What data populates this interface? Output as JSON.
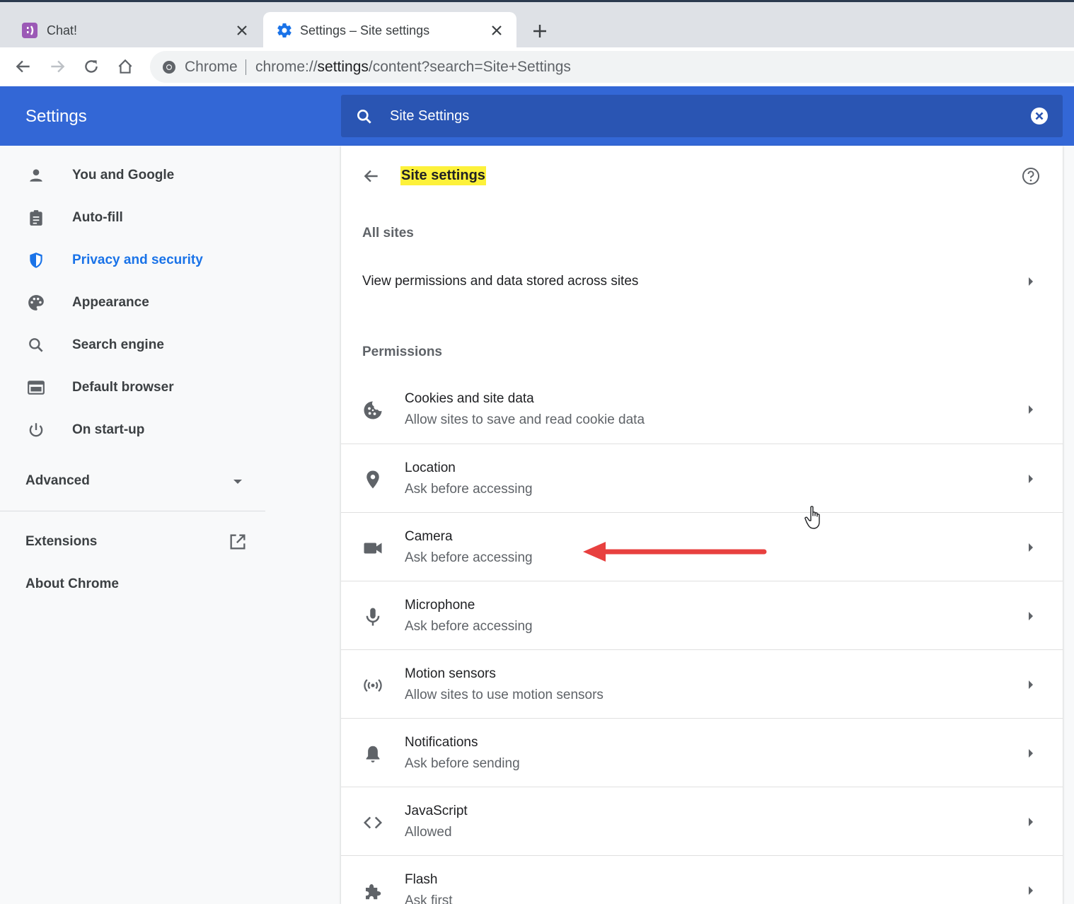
{
  "browser": {
    "tabs": [
      {
        "title": "Chat!",
        "favicon": "chat-app-icon",
        "active": false
      },
      {
        "title": "Settings – Site settings",
        "favicon": "gear-icon",
        "active": true
      }
    ],
    "omnibox": {
      "chip": "Chrome",
      "url_scheme": "chrome://",
      "url_host": "settings",
      "url_path": "/content?search=Site+Settings"
    }
  },
  "header": {
    "title": "Settings",
    "search_value": "Site Settings"
  },
  "sidebar": {
    "items": [
      {
        "label": "You and Google",
        "icon": "person-icon"
      },
      {
        "label": "Auto-fill",
        "icon": "clipboard-icon"
      },
      {
        "label": "Privacy and security",
        "icon": "shield-icon",
        "selected": true
      },
      {
        "label": "Appearance",
        "icon": "palette-icon"
      },
      {
        "label": "Search engine",
        "icon": "search-icon"
      },
      {
        "label": "Default browser",
        "icon": "browser-window-icon"
      },
      {
        "label": "On start-up",
        "icon": "power-icon"
      }
    ],
    "advanced": "Advanced",
    "extensions": "Extensions",
    "about": "About Chrome"
  },
  "main": {
    "title": "Site settings",
    "all_sites_label": "All sites",
    "all_sites_row": "View permissions and data stored across sites",
    "permissions_label": "Permissions",
    "permissions": [
      {
        "title": "Cookies and site data",
        "subtitle": "Allow sites to save and read cookie data",
        "icon": "cookie-icon"
      },
      {
        "title": "Location",
        "subtitle": "Ask before accessing",
        "icon": "location-pin-icon"
      },
      {
        "title": "Camera",
        "subtitle": "Ask before accessing",
        "icon": "video-camera-icon"
      },
      {
        "title": "Microphone",
        "subtitle": "Ask before accessing",
        "icon": "microphone-icon"
      },
      {
        "title": "Motion sensors",
        "subtitle": "Allow sites to use motion sensors",
        "icon": "sensors-icon"
      },
      {
        "title": "Notifications",
        "subtitle": "Ask before sending",
        "icon": "bell-icon"
      },
      {
        "title": "JavaScript",
        "subtitle": "Allowed",
        "icon": "code-icon"
      },
      {
        "title": "Flash",
        "subtitle": "Ask first",
        "icon": "puzzle-icon"
      }
    ]
  },
  "colors": {
    "header_blue": "#3367d6",
    "search_blue": "#2a55b3",
    "accent": "#1a73e8",
    "highlight": "#fdf13a",
    "annotation_red": "#e8403f"
  }
}
